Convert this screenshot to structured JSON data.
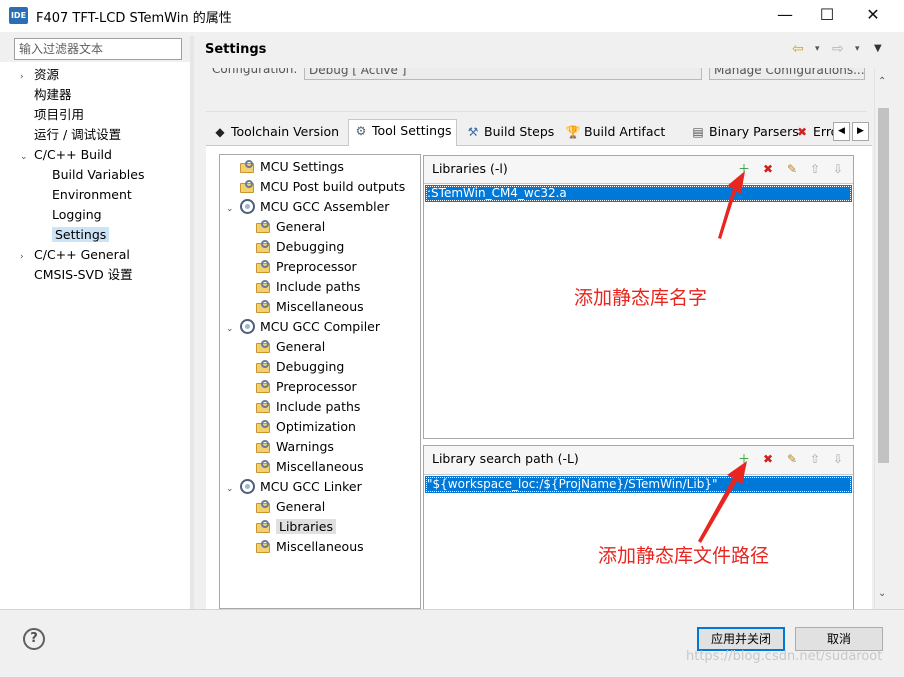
{
  "window": {
    "icon_label": "IDE",
    "title": "F407 TFT-LCD STemWin 的属性",
    "minimize": "—",
    "maximize": "☐",
    "close": "✕"
  },
  "filter": {
    "placeholder": "输入过滤器文本"
  },
  "left_tree": [
    {
      "label": "资源",
      "toggle": "›"
    },
    {
      "label": "构建器",
      "toggle": ""
    },
    {
      "label": "项目引用",
      "toggle": ""
    },
    {
      "label": "运行 / 调试设置",
      "toggle": ""
    },
    {
      "label": "C/C++ Build",
      "toggle": "⌄"
    },
    {
      "label": "Build Variables",
      "toggle": ""
    },
    {
      "label": "Environment",
      "toggle": ""
    },
    {
      "label": "Logging",
      "toggle": ""
    },
    {
      "label": "Settings",
      "toggle": "",
      "selected": true
    },
    {
      "label": "C/C++ General",
      "toggle": "›"
    },
    {
      "label": "CMSIS-SVD 设置",
      "toggle": ""
    }
  ],
  "header": {
    "title": "Settings",
    "back_icon": "⇦",
    "forward_icon": "⇨",
    "dropdown_icon": "▾",
    "menu_icon": "▼"
  },
  "config": {
    "label": "Configuration:",
    "value": "Debug [ Active ]",
    "manage_button": "Manage Configurations..."
  },
  "tabs": [
    {
      "label": "Toolchain Version",
      "icon": "◆",
      "active": false
    },
    {
      "label": "Tool Settings",
      "icon": "⚙",
      "active": true
    },
    {
      "label": "Build Steps",
      "icon": "⚒",
      "active": false
    },
    {
      "label": "Build Artifact",
      "icon": "🏆",
      "active": false
    },
    {
      "label": "Binary Parsers",
      "icon": "▤",
      "active": false
    },
    {
      "label": "Erro",
      "icon": "✖",
      "active": false
    }
  ],
  "tab_nav": {
    "left": "◀",
    "right": "▶"
  },
  "tool_tree": [
    {
      "label": "MCU Settings",
      "kind": "settings",
      "level": 0
    },
    {
      "label": "MCU Post build outputs",
      "kind": "settings",
      "level": 0
    },
    {
      "label": "MCU GCC Assembler",
      "kind": "tool",
      "level": 0,
      "toggle": "⌄"
    },
    {
      "label": "General",
      "kind": "settings",
      "level": 1
    },
    {
      "label": "Debugging",
      "kind": "settings",
      "level": 1
    },
    {
      "label": "Preprocessor",
      "kind": "settings",
      "level": 1
    },
    {
      "label": "Include paths",
      "kind": "settings",
      "level": 1
    },
    {
      "label": "Miscellaneous",
      "kind": "settings",
      "level": 1
    },
    {
      "label": "MCU GCC Compiler",
      "kind": "tool",
      "level": 0,
      "toggle": "⌄"
    },
    {
      "label": "General",
      "kind": "settings",
      "level": 1
    },
    {
      "label": "Debugging",
      "kind": "settings",
      "level": 1
    },
    {
      "label": "Preprocessor",
      "kind": "settings",
      "level": 1
    },
    {
      "label": "Include paths",
      "kind": "settings",
      "level": 1
    },
    {
      "label": "Optimization",
      "kind": "settings",
      "level": 1
    },
    {
      "label": "Warnings",
      "kind": "settings",
      "level": 1
    },
    {
      "label": "Miscellaneous",
      "kind": "settings",
      "level": 1
    },
    {
      "label": "MCU GCC Linker",
      "kind": "tool",
      "level": 0,
      "toggle": "⌄"
    },
    {
      "label": "General",
      "kind": "settings",
      "level": 1
    },
    {
      "label": "Libraries",
      "kind": "settings",
      "level": 1,
      "selected": true
    },
    {
      "label": "Miscellaneous",
      "kind": "settings",
      "level": 1
    }
  ],
  "libraries": {
    "title": "Libraries (-l)",
    "items": [
      ":STemWin_CM4_wc32.a"
    ]
  },
  "library_paths": {
    "title": "Library search path (-L)",
    "items": [
      "\"${workspace_loc:/${ProjName}/STemWin/Lib}\""
    ]
  },
  "list_toolbar": {
    "add": "＋",
    "delete": "✖",
    "edit": "✎",
    "up": "⇧",
    "down": "⇩",
    "colors": {
      "add": "#2f9d2f",
      "delete": "#d02020",
      "edit": "#b08a20",
      "disabled": "#a8a8a8"
    }
  },
  "annotations": {
    "lib_name": "添加静态库名字",
    "lib_path": "添加静态库文件路径",
    "color": "#e8261f"
  },
  "buttons": {
    "help": "?",
    "apply_close": "应用并关闭",
    "cancel": "取消"
  },
  "watermark": "https://blog.csdn.net/sudaroot"
}
